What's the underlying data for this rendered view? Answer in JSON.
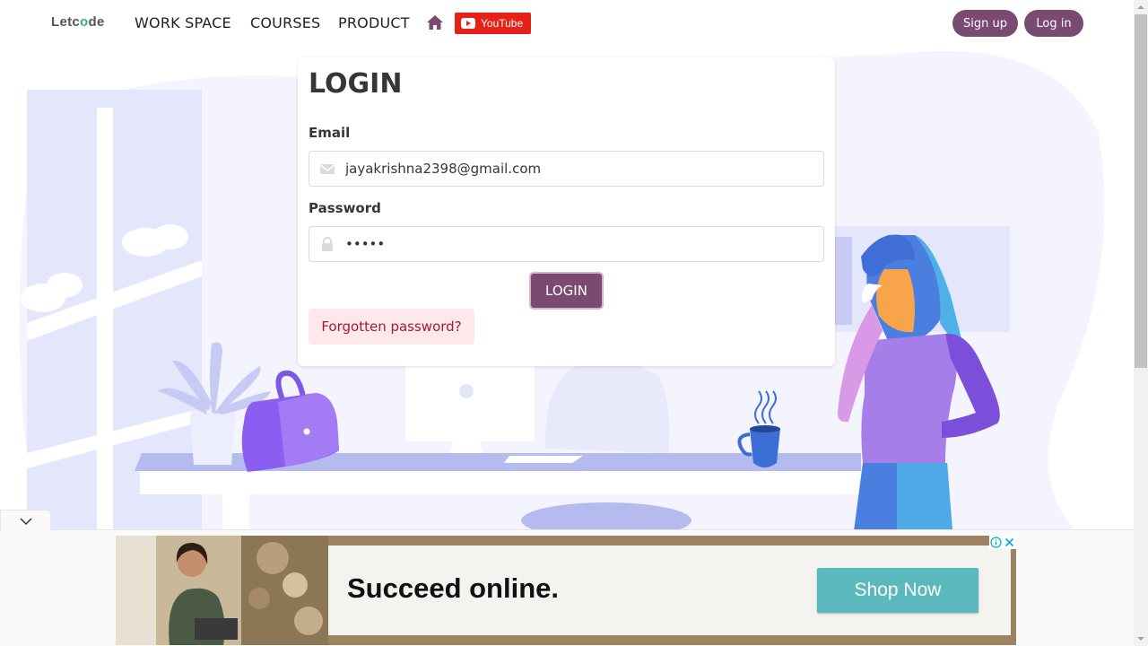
{
  "brand": {
    "logo_pre": "Letc",
    "logo_o": "o",
    "logo_post": "de"
  },
  "nav": {
    "links": [
      {
        "label": "WORK SPACE"
      },
      {
        "label": "COURSES"
      },
      {
        "label": "PRODUCT"
      }
    ],
    "youtube_label": "YouTube",
    "signup_label": "Sign up",
    "login_label": "Log in"
  },
  "login_card": {
    "title": "LOGIN",
    "email_label": "Email",
    "email_value": "jayakrishna2398@gmail.com",
    "password_label": "Password",
    "password_value": "•••••",
    "submit_label": "LOGIN",
    "forgot_label": "Forgotten password?"
  },
  "ad": {
    "headline": "Succeed online.",
    "cta_label": "Shop Now"
  },
  "colors": {
    "brand_purple": "#7a4a70",
    "forgot_bg": "#fde8ec",
    "forgot_text": "#a7183c",
    "youtube_red": "#e62117",
    "ad_cta": "#5ab9bc"
  },
  "icons": [
    "home-icon",
    "youtube-play-icon",
    "envelope-icon",
    "lock-icon",
    "chevron-down-icon",
    "ad-info-icon",
    "ad-close-icon"
  ]
}
